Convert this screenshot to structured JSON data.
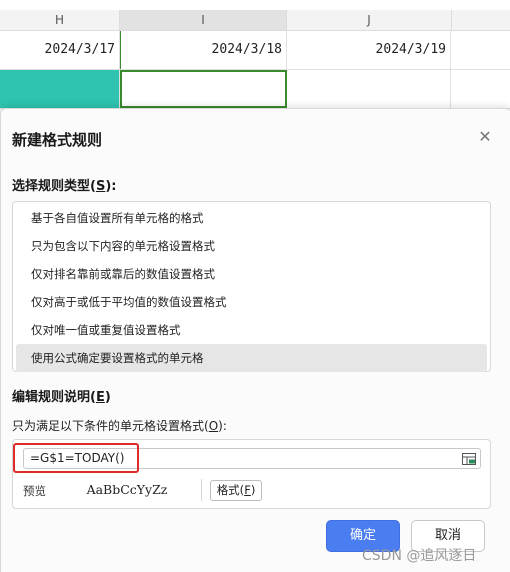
{
  "spreadsheet": {
    "columns": [
      "H",
      "I",
      "J"
    ],
    "dates": [
      "2024/3/17",
      "2024/3/18",
      "2024/3/19"
    ]
  },
  "dialog": {
    "title": "新建格式规则",
    "rule_type_label_prefix": "选择规则类型(",
    "rule_type_label_key": "S",
    "rule_type_label_suffix": "):",
    "rule_types": [
      "基于各自值设置所有单元格的格式",
      "只为包含以下内容的单元格设置格式",
      "仅对排名靠前或靠后的数值设置格式",
      "仅对高于或低于平均值的数值设置格式",
      "仅对唯一值或重复值设置格式",
      "使用公式确定要设置格式的单元格"
    ],
    "selected_rule_index": 5,
    "edit_label_prefix": "编辑规则说明(",
    "edit_label_key": "E",
    "edit_label_suffix": ")",
    "formula_label_prefix": "只为满足以下条件的单元格设置格式(",
    "formula_label_key": "O",
    "formula_label_suffix": "):",
    "formula_value": "=G$1=TODAY()",
    "preview_label": "预览",
    "preview_sample": "AaBbCcYyZz",
    "format_button_prefix": "格式(",
    "format_button_key": "F",
    "format_button_suffix": ")",
    "ok_label": "确定",
    "cancel_label": "取消"
  },
  "watermark": "CSDN @追风逐日",
  "colors": {
    "teal_fill": "#2ec4b0",
    "active_border": "#3a8a2e",
    "primary_button": "#4a7df0",
    "highlight_box": "#e02b2b"
  }
}
